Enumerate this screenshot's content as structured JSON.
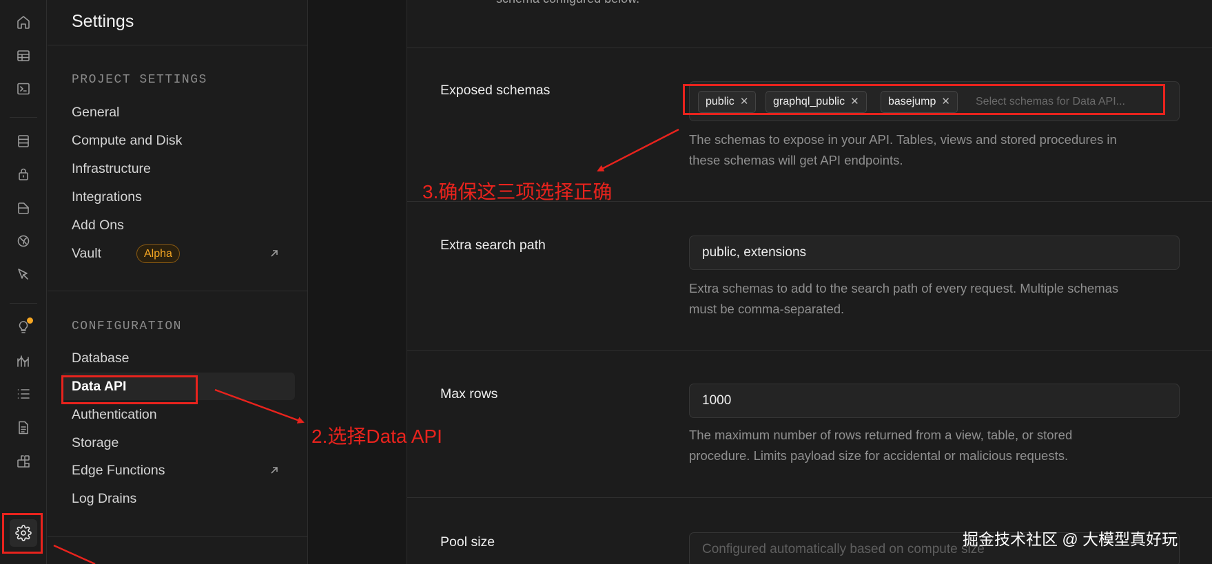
{
  "rail": {
    "icons": [
      "home-icon",
      "table-editor-icon",
      "sql-editor-icon",
      "database-icon",
      "auth-lock-icon",
      "storage-icon",
      "realtime-icon",
      "edge-functions-icon",
      "advisors-bulb-icon",
      "reports-icon",
      "logs-list-icon",
      "api-docs-icon",
      "integrations-icon",
      "settings-gear-icon"
    ]
  },
  "menu": {
    "title": "Settings",
    "project_settings": {
      "title": "PROJECT SETTINGS",
      "items": [
        "General",
        "Compute and Disk",
        "Infrastructure",
        "Integrations",
        "Add Ons",
        "Vault"
      ],
      "vault_badge": "Alpha"
    },
    "configuration": {
      "title": "CONFIGURATION",
      "items": [
        "Database",
        "Data API",
        "Authentication",
        "Storage",
        "Edge Functions",
        "Log Drains"
      ]
    }
  },
  "main": {
    "top_text": "schema configured below.",
    "exposed_schemas": {
      "label": "Exposed schemas",
      "chips": [
        "public",
        "graphql_public",
        "basejump"
      ],
      "placeholder": "Select schemas for Data API...",
      "help_1": "The schemas to expose in your API. Tables, views and stored procedures in",
      "help_2": "these schemas will get API endpoints."
    },
    "extra_search_path": {
      "label": "Extra search path",
      "value": "public, extensions",
      "help_1": "Extra schemas to add to the search path of every request. Multiple schemas",
      "help_2": "must be comma-separated."
    },
    "max_rows": {
      "label": "Max rows",
      "value": "1000",
      "help_1": "The maximum number of rows returned from a view, table, or stored",
      "help_2": "procedure. Limits payload size for accidental or malicious requests."
    },
    "pool_size": {
      "label": "Pool size",
      "placeholder": "Configured automatically based on compute size"
    }
  },
  "annotations": {
    "step2": "2.选择Data API",
    "step3": "3.确保这三项选择正确",
    "color": "#e8231d"
  },
  "watermark": "掘金技术社区 @ 大模型真好玩"
}
